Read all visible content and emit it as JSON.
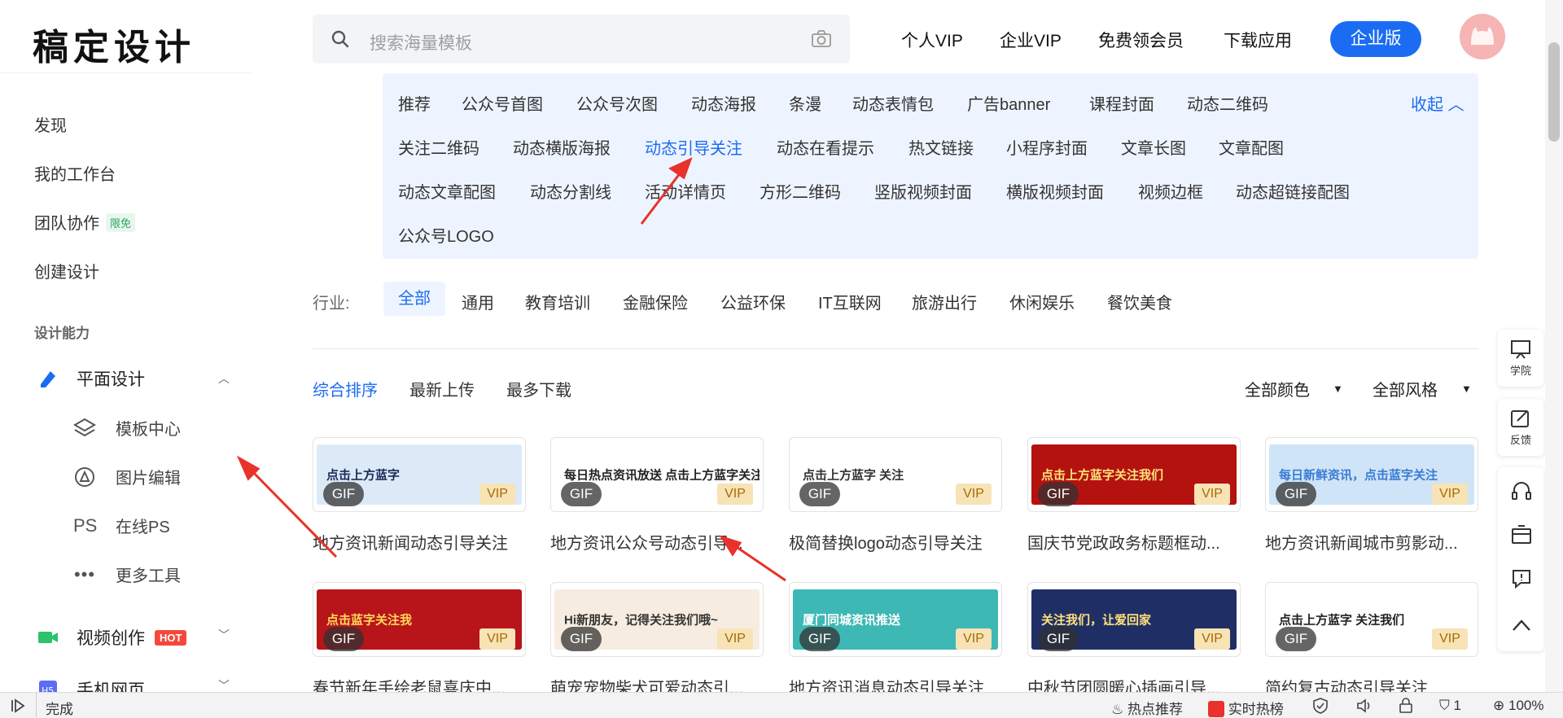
{
  "header": {
    "logo": "稿定设计",
    "search_placeholder": "搜索海量模板",
    "nav": [
      "个人VIP",
      "企业VIP",
      "免费领会员",
      "下载应用"
    ],
    "enterprise_button": "企业版"
  },
  "sidebar": {
    "discover": "发现",
    "workspace": "我的工作台",
    "team": "团队协作",
    "team_badge": "限免",
    "create": "创建设计",
    "section_title": "设计能力",
    "graphic_design": "平面设计",
    "template_center": "模板中心",
    "image_edit": "图片编辑",
    "ps_icon": "PS",
    "online_ps": "在线PS",
    "more_tools": "更多工具",
    "video": "视频创作",
    "video_badge": "HOT",
    "mobile_web": "手机网页"
  },
  "categories": {
    "row1": [
      "推荐",
      "公众号首图",
      "公众号次图",
      "动态海报",
      "条漫",
      "动态表情包",
      "广告banner",
      "课程封面",
      "动态二维码"
    ],
    "row2": [
      "关注二维码",
      "动态横版海报",
      "动态引导关注",
      "动态在看提示",
      "热文链接",
      "小程序封面",
      "文章长图",
      "文章配图"
    ],
    "row3": [
      "动态文章配图",
      "动态分割线",
      "活动详情页",
      "方形二维码",
      "竖版视频封面",
      "横版视频封面",
      "视频边框",
      "动态超链接配图"
    ],
    "row4": [
      "公众号LOGO"
    ],
    "active": "动态引导关注",
    "collapse": "收起"
  },
  "industry": {
    "label": "行业:",
    "active": "全部",
    "items": [
      "通用",
      "教育培训",
      "金融保险",
      "公益环保",
      "IT互联网",
      "旅游出行",
      "休闲娱乐",
      "餐饮美食"
    ]
  },
  "sort": {
    "items": [
      "综合排序",
      "最新上传",
      "最多下载"
    ],
    "active": "综合排序",
    "color_filter": "全部颜色",
    "style_filter": "全部风格"
  },
  "cards": [
    {
      "title": "地方资讯新闻动态引导关注",
      "banner": "点击上方蓝字",
      "bg": "#dceaf8",
      "fg": "#1b2a55"
    },
    {
      "title": "地方资讯公众号动态引导...",
      "banner": "每日热点资讯放送 点击上方蓝字关注",
      "bg": "#ffffff",
      "fg": "#222222"
    },
    {
      "title": "极简替换logo动态引导关注",
      "banner": "点击上方蓝字 关注",
      "bg": "#ffffff",
      "fg": "#333333"
    },
    {
      "title": "国庆节党政政务标题框动...",
      "banner": "点击上方蓝字关注我们",
      "bg": "#b3120f",
      "fg": "#ffe27a"
    },
    {
      "title": "地方资讯新闻城市剪影动...",
      "banner": "每日新鲜资讯，点击蓝字关注",
      "bg": "#cfe4f7",
      "fg": "#3a7bd5"
    },
    {
      "title": "春节新年手绘老鼠喜庆中...",
      "banner": "点击蓝字关注我",
      "bg": "#b8151b",
      "fg": "#ffd95a"
    },
    {
      "title": "萌宠宠物柴犬可爱动态引...",
      "banner": "Hi新朋友，记得关注我们哦~",
      "bg": "#f7ece0",
      "fg": "#333333"
    },
    {
      "title": "地方资讯消息动态引导关注",
      "banner": "厦门同城资讯推送",
      "bg": "#3db8b5",
      "fg": "#ffffff"
    },
    {
      "title": "中秋节团圆暖心插画引导...",
      "banner": "关注我们，让爱回家",
      "bg": "#1f2f66",
      "fg": "#ffe27a"
    },
    {
      "title": "简约复古动态引导关注",
      "banner": "点击上方蓝字 关注我们",
      "bg": "#ffffff",
      "fg": "#222222"
    }
  ],
  "card_labels": {
    "gif": "GIF",
    "vip": "VIP"
  },
  "float_tools": {
    "academy": "学院",
    "feedback": "反馈"
  },
  "statusbar": {
    "done": "完成",
    "hot_recommend": "热点推荐",
    "realtime_hot": "实时热榜",
    "count": "1",
    "zoom": "100%"
  },
  "colors": {
    "accent": "#1a6cf2",
    "hot": "#f5483b",
    "annotation": "#e8322b"
  }
}
